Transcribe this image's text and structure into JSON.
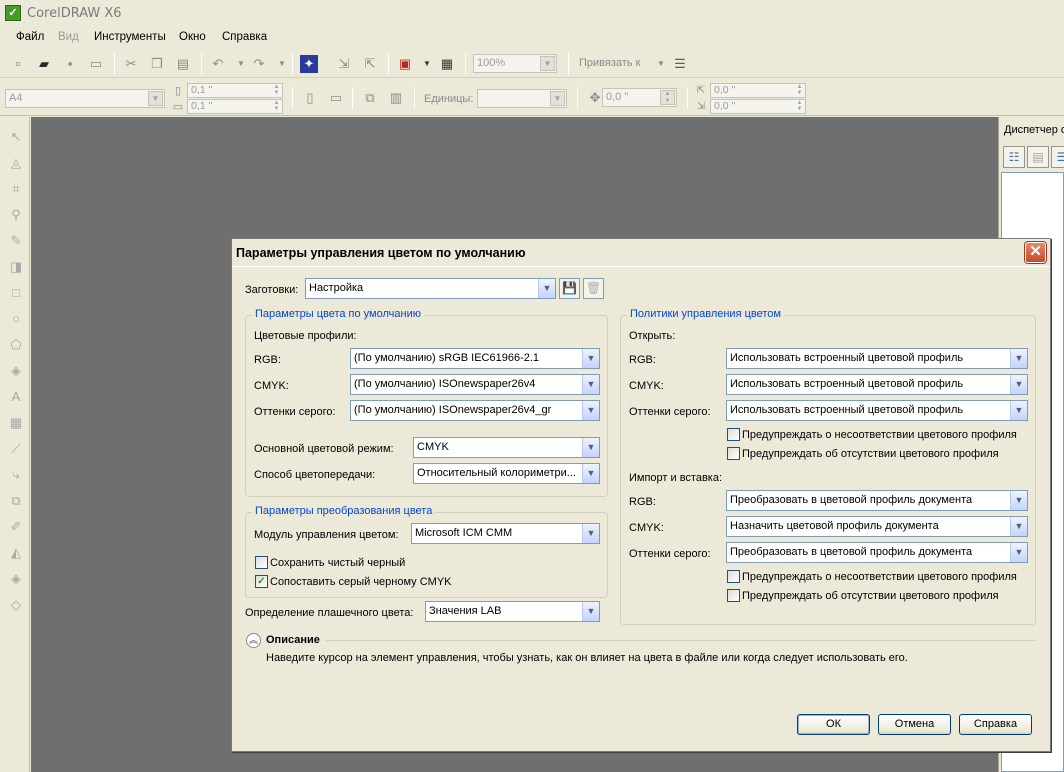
{
  "app": {
    "title": "CorelDRAW X6"
  },
  "menu": [
    "Файл",
    "Вид",
    "Инструменты",
    "Окно",
    "Справка"
  ],
  "toolbar": {
    "zoom": "100%",
    "snap": "Привязать к"
  },
  "propbar": {
    "page_size": "A4",
    "width": "0,1 \"",
    "height": "0,1 \"",
    "units_label": "Единицы:",
    "units_value": "",
    "nudge": "0,0 \"",
    "dup_x": "0,0 \"",
    "dup_y": "0,0 \""
  },
  "docker": {
    "title": "Диспетчер о"
  },
  "dialog": {
    "title": "Параметры управления цветом по умолчанию",
    "presets_label": "Заготовки:",
    "presets_value": "Настройка",
    "default_group": {
      "legend": "Параметры цвета по умолчанию",
      "profiles_label": "Цветовые профили:",
      "rgb_label": "RGB:",
      "rgb_value": "(По умолчанию) sRGB IEC61966-2.1",
      "cmyk_label": "CMYK:",
      "cmyk_value": "(По умолчанию) ISOnewspaper26v4",
      "gray_label": "Оттенки серого:",
      "gray_value": "(По умолчанию) ISOnewspaper26v4_gr",
      "mode_label": "Основной цветовой режим:",
      "mode_value": "CMYK",
      "intent_label": "Способ цветопередачи:",
      "intent_value": "Относительный колориметри..."
    },
    "conversion_group": {
      "legend": "Параметры преобразования цвета",
      "engine_label": "Модуль управления цветом:",
      "engine_value": "Microsoft ICM CMM",
      "preserve_black": "Сохранить чистый черный",
      "preserve_black_checked": false,
      "map_gray": "Сопоставить серый черному CMYK",
      "map_gray_checked": true
    },
    "spot_label": "Определение плашечного цвета:",
    "spot_value": "Значения LAB",
    "policy_group": {
      "legend": "Политики управления цветом",
      "open_label": "Открыть:",
      "open_rgb_label": "RGB:",
      "open_rgb_value": "Использовать встроенный цветовой профиль",
      "open_cmyk_label": "CMYK:",
      "open_cmyk_value": "Использовать встроенный цветовой профиль",
      "open_gray_label": "Оттенки серого:",
      "open_gray_value": "Использовать встроенный цветовой профиль",
      "open_warn_mismatch": "Предупреждать о несоответствии цветового профиля",
      "open_warn_missing": "Предупреждать об отсутствии цветового профиля",
      "import_label": "Импорт и вставка:",
      "imp_rgb_label": "RGB:",
      "imp_rgb_value": "Преобразовать в цветовой профиль документа",
      "imp_cmyk_label": "CMYK:",
      "imp_cmyk_value": "Назначить цветовой профиль документа",
      "imp_gray_label": "Оттенки серого:",
      "imp_gray_value": "Преобразовать в цветовой профиль документа",
      "imp_warn_mismatch": "Предупреждать о несоответствии цветового профиля",
      "imp_warn_missing": "Предупреждать об отсутствии цветового профиля"
    },
    "description": {
      "title": "Описание",
      "text": "Наведите курсор на элемент управления, чтобы узнать, как он влияет на цвета в файле или когда следует использовать его."
    },
    "buttons": {
      "ok": "ОК",
      "cancel": "Отмена",
      "help": "Справка"
    }
  }
}
